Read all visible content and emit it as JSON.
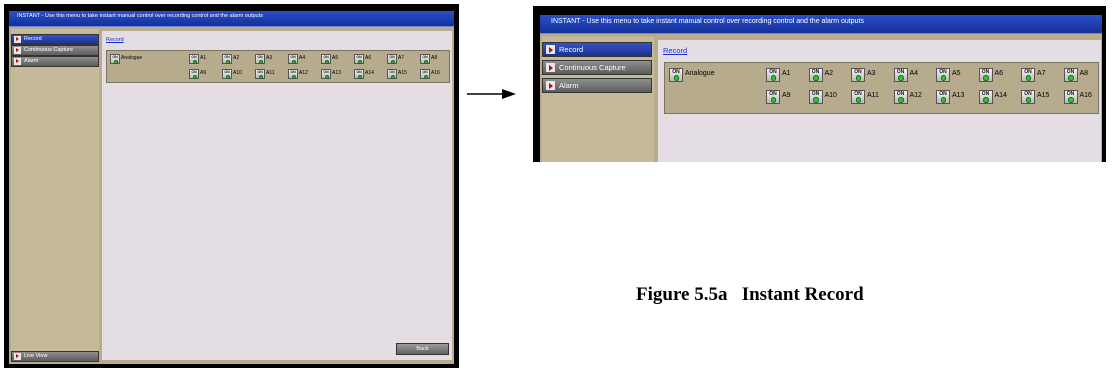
{
  "title_bar": "INSTANT - Use this menu to take instant manual control over recording control and the alarm outputs",
  "menu": [
    {
      "label": "Record",
      "active": true
    },
    {
      "label": "Continuous Capture",
      "active": false
    },
    {
      "label": "Alarm",
      "active": false
    }
  ],
  "live_view_label": "Live View",
  "section_link": "Record",
  "group": {
    "label": "Analogue",
    "button_text": "ON",
    "channels": [
      "A1",
      "A2",
      "A3",
      "A4",
      "A5",
      "A6",
      "A7",
      "A8",
      "A9",
      "A10",
      "A11",
      "A12",
      "A13",
      "A14",
      "A15",
      "A16"
    ]
  },
  "back_label": "Back",
  "caption": "Figure 5.5a   Instant Record",
  "colors": {
    "title_bar": "#1f3fb8",
    "menu_active": "#2a44b0",
    "menu_inactive": "#757575",
    "sidebar": "#c4b998",
    "content": "#e4dde3",
    "group_box": "#b6ac8d",
    "led": "#2ec433",
    "link": "#1b2fcf"
  }
}
